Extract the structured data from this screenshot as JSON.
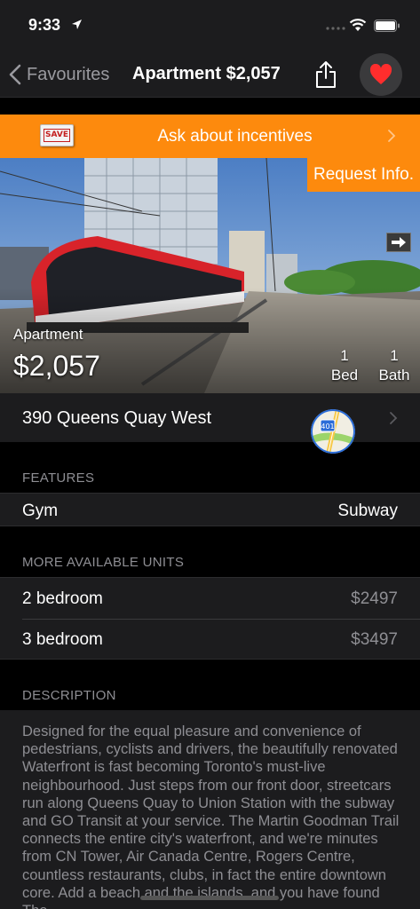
{
  "status_bar": {
    "time": "9:33"
  },
  "nav": {
    "back_label": "Favourites",
    "title": "Apartment $2,057"
  },
  "promo": {
    "badge_text": "SAVE",
    "text": "Ask about incentives"
  },
  "hero": {
    "request_label": "Request Info.",
    "type": "Apartment",
    "price": "$2,057",
    "beds_count": "1",
    "beds_label": "Bed",
    "baths_count": "1",
    "baths_label": "Bath"
  },
  "address": {
    "text": "390 Queens Quay West",
    "maps_badge": "401"
  },
  "features": {
    "header": "FEATURES",
    "left": "Gym",
    "right": "Subway"
  },
  "units": {
    "header": "MORE AVAILABLE UNITS",
    "items": [
      {
        "label": "2 bedroom",
        "price": "$2497"
      },
      {
        "label": "3 bedroom",
        "price": "$3497"
      }
    ]
  },
  "description": {
    "header": "DESCRIPTION",
    "text": "Designed for the equal pleasure and convenience of pedestrians, cyclists and drivers, the beautifully renovated Waterfront is fast becoming Toronto's must-live neighbourhood. Just steps from our front door, streetcars run along Queens Quay to Union Station with the subway and GO Transit at your service. The Martin Goodman Trail connects the entire city's waterfront, and we're minutes from CN Tower, Air Canada Centre, Rogers Centre, countless restaurants, clubs, in fact the entire downtown core. Add a beach and the islands, and you have found The"
  },
  "colors": {
    "accent_orange": "#fd8a0d",
    "heart_red": "#ff2d2d",
    "row_bg": "#1c1c1e",
    "secondary_text": "#8e8e93"
  },
  "icons": [
    "location-arrow-icon",
    "wifi-icon",
    "battery-icon",
    "chevron-left-icon",
    "share-icon",
    "heart-icon",
    "chevron-right-icon",
    "arrow-right-icon",
    "maps-app-icon"
  ]
}
